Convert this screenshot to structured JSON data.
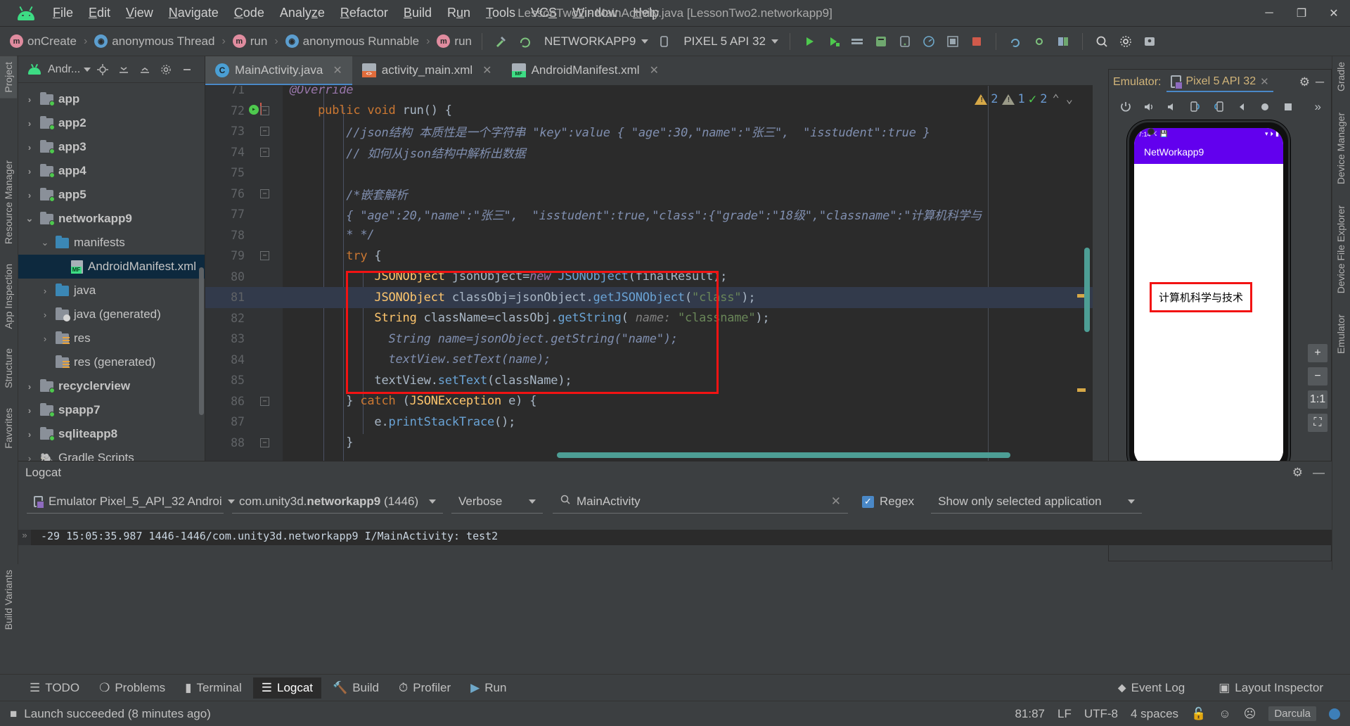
{
  "window": {
    "title": "LessonTwo2 - MainActivity.java [LessonTwo2.networkapp9]",
    "minimize": "─",
    "maximize": "❐",
    "close": "✕"
  },
  "menubar": {
    "items": [
      "File",
      "Edit",
      "View",
      "Navigate",
      "Code",
      "Analyze",
      "Refactor",
      "Build",
      "Run",
      "Tools",
      "VCS",
      "Window",
      "Help"
    ]
  },
  "navbar": {
    "crumbs": [
      {
        "label": "onCreate",
        "icon": "method-icon"
      },
      {
        "label": "anonymous Thread",
        "icon": "class-icon"
      },
      {
        "label": "run",
        "icon": "method-icon"
      },
      {
        "label": "anonymous Runnable",
        "icon": "class-icon"
      },
      {
        "label": "run",
        "icon": "method-icon"
      }
    ],
    "separator": "›",
    "run_config": "NETWORKAPP9",
    "device": "PIXEL 5 API 32"
  },
  "left_strips": {
    "top": [
      "Project"
    ],
    "mid": [
      "Resource Manager",
      "App Inspection",
      "Structure",
      "Favorites"
    ],
    "bottom": [
      "Build Variants"
    ]
  },
  "right_strips": [
    "Gradle",
    "Device Manager",
    "Device File Explorer",
    "Emulator"
  ],
  "project_panel": {
    "title": "Andr...",
    "toolbar_icons": [
      "locate-icon",
      "expand-all-icon",
      "collapse-all-icon",
      "settings-icon",
      "hide-icon"
    ],
    "tree": [
      {
        "label": "app",
        "depth": 0,
        "arrow": "›",
        "icon": "module-folder",
        "bold": true
      },
      {
        "label": "app2",
        "depth": 0,
        "arrow": "›",
        "icon": "module-folder",
        "bold": true
      },
      {
        "label": "app3",
        "depth": 0,
        "arrow": "›",
        "icon": "module-folder",
        "bold": true
      },
      {
        "label": "app4",
        "depth": 0,
        "arrow": "›",
        "icon": "module-folder",
        "bold": true
      },
      {
        "label": "app5",
        "depth": 0,
        "arrow": "›",
        "icon": "module-folder",
        "bold": true
      },
      {
        "label": "networkapp9",
        "depth": 0,
        "arrow": "⌄",
        "icon": "module-folder",
        "bold": true
      },
      {
        "label": "manifests",
        "depth": 1,
        "arrow": "⌄",
        "icon": "blue-folder",
        "bold": false
      },
      {
        "label": "AndroidManifest.xml",
        "depth": 2,
        "arrow": "",
        "icon": "manifest-file",
        "bold": false,
        "selected": true
      },
      {
        "label": "java",
        "depth": 1,
        "arrow": "›",
        "icon": "blue-folder",
        "bold": false
      },
      {
        "label": "java (generated)",
        "depth": 1,
        "arrow": "›",
        "icon": "generated-folder",
        "bold": false
      },
      {
        "label": "res",
        "depth": 1,
        "arrow": "›",
        "icon": "res-folder",
        "bold": false
      },
      {
        "label": "res (generated)",
        "depth": 1,
        "arrow": "",
        "icon": "res-folder",
        "bold": false
      },
      {
        "label": "recyclerview",
        "depth": 0,
        "arrow": "›",
        "icon": "module-folder",
        "bold": true
      },
      {
        "label": "spapp7",
        "depth": 0,
        "arrow": "›",
        "icon": "module-folder",
        "bold": true
      },
      {
        "label": "sqliteapp8",
        "depth": 0,
        "arrow": "›",
        "icon": "module-folder",
        "bold": true
      },
      {
        "label": "Gradle Scripts",
        "depth": 0,
        "arrow": "›",
        "icon": "gradle-icon",
        "bold": false
      }
    ]
  },
  "editor": {
    "tabs": [
      {
        "label": "MainActivity.java",
        "icon": "java-class-icon",
        "active": true,
        "close": "✕"
      },
      {
        "label": "activity_main.xml",
        "icon": "xml-layout-icon",
        "active": false,
        "close": "✕"
      },
      {
        "label": "AndroidManifest.xml",
        "icon": "manifest-icon",
        "active": false,
        "close": "✕"
      }
    ],
    "inspections": {
      "warnings": "2",
      "weak_warnings": "1",
      "ok": "2",
      "prev": "⌃",
      "next": "⌄"
    },
    "lines": [
      {
        "num": "71",
        "partial": true,
        "segments": [
          {
            "t": "@Override",
            "c": "kw2"
          }
        ]
      },
      {
        "num": "72",
        "fold": "⊖",
        "breakpoint": true,
        "segments": [
          {
            "t": "    ",
            "c": "pln"
          },
          {
            "t": "public",
            "c": "kw"
          },
          {
            "t": " ",
            "c": "pln"
          },
          {
            "t": "void",
            "c": "kw"
          },
          {
            "t": " run() {",
            "c": "pln"
          }
        ]
      },
      {
        "num": "73",
        "fold": "⊖",
        "segments": [
          {
            "t": "        //json结构 本质性是一个字符串 \"key\":value { \"age\":30,\"name\":\"张三\",  \"isstudent\":true }",
            "c": "cmtz"
          }
        ]
      },
      {
        "num": "74",
        "fold": "⊖",
        "segments": [
          {
            "t": "        // 如何从json结构中解析出数据",
            "c": "cmtz"
          }
        ]
      },
      {
        "num": "75",
        "segments": []
      },
      {
        "num": "76",
        "fold": "⊖",
        "segments": [
          {
            "t": "        /*嵌套解析",
            "c": "cmtz"
          }
        ]
      },
      {
        "num": "77",
        "segments": [
          {
            "t": "        { \"age\":20,\"name\":\"张三\",  \"isstudent\":true,\"class\":{\"grade\":\"18级\",\"classname\":\"计算机科学与",
            "c": "cmtz"
          }
        ]
      },
      {
        "num": "78",
        "segments": [
          {
            "t": "        * */",
            "c": "cmtz"
          }
        ]
      },
      {
        "num": "79",
        "fold": "⊖",
        "segments": [
          {
            "t": "        ",
            "c": "pln"
          },
          {
            "t": "try",
            "c": "kw"
          },
          {
            "t": " {",
            "c": "pln"
          }
        ]
      },
      {
        "num": "80",
        "segments": [
          {
            "t": "            ",
            "c": "pln"
          },
          {
            "t": "JSONObject",
            "c": "fld"
          },
          {
            "t": " jsonObject=",
            "c": "pln"
          },
          {
            "t": "new",
            "c": "kw2"
          },
          {
            "t": " ",
            "c": "pln"
          },
          {
            "t": "JSONObject",
            "c": "mth"
          },
          {
            "t": "(finalResult);",
            "c": "pln"
          }
        ]
      },
      {
        "num": "81",
        "highlight": true,
        "segments": [
          {
            "t": "            ",
            "c": "pln"
          },
          {
            "t": "JSONObject",
            "c": "fld"
          },
          {
            "t": " classObj=jsonObject.",
            "c": "pln"
          },
          {
            "t": "getJSONObject",
            "c": "mth"
          },
          {
            "t": "(",
            "c": "pln"
          },
          {
            "t": "\"class\"",
            "c": "str"
          },
          {
            "t": ");",
            "c": "pln"
          }
        ]
      },
      {
        "num": "82",
        "segments": [
          {
            "t": "            ",
            "c": "pln"
          },
          {
            "t": "String",
            "c": "fld"
          },
          {
            "t": " className=classObj.",
            "c": "pln"
          },
          {
            "t": "getString",
            "c": "mth"
          },
          {
            "t": "( ",
            "c": "pln"
          },
          {
            "t": "name:",
            "c": "hint"
          },
          {
            "t": " ",
            "c": "pln"
          },
          {
            "t": "\"classname\"",
            "c": "str"
          },
          {
            "t": ");",
            "c": "pln"
          }
        ]
      },
      {
        "num": "83",
        "segments": [
          {
            "t": "              ",
            "c": "pln"
          },
          {
            "t": "String name=jsonObject.getString(\"name\");",
            "c": "cmtz"
          }
        ]
      },
      {
        "num": "84",
        "segments": [
          {
            "t": "              ",
            "c": "pln"
          },
          {
            "t": "textView.setText(name);",
            "c": "cmtz"
          }
        ]
      },
      {
        "num": "85",
        "segments": [
          {
            "t": "            textView.",
            "c": "pln"
          },
          {
            "t": "setText",
            "c": "mth"
          },
          {
            "t": "(className);",
            "c": "pln"
          }
        ]
      },
      {
        "num": "86",
        "fold": "⊖",
        "segments": [
          {
            "t": "        } ",
            "c": "pln"
          },
          {
            "t": "catch",
            "c": "kw"
          },
          {
            "t": " (",
            "c": "pln"
          },
          {
            "t": "JSONException",
            "c": "fld"
          },
          {
            "t": " e) {",
            "c": "pln"
          }
        ]
      },
      {
        "num": "87",
        "segments": [
          {
            "t": "            e.",
            "c": "pln"
          },
          {
            "t": "printStackTrace",
            "c": "mth"
          },
          {
            "t": "();",
            "c": "pln"
          }
        ]
      },
      {
        "num": "88",
        "fold": "⊖",
        "segments": [
          {
            "t": "        }",
            "c": "pln"
          }
        ]
      }
    ]
  },
  "emulator": {
    "title": "Emulator:",
    "tab_label": "Pixel 5 API 32",
    "tab_close": "✕",
    "gear": "⚙",
    "minimize": "─",
    "toolbar_icons": [
      "power-icon",
      "volume-up-icon",
      "volume-down-icon",
      "rotate-left-icon",
      "rotate-right-icon",
      "back-icon",
      "home-icon",
      "overview-icon",
      "more-icon"
    ],
    "more": "»",
    "device_screen": {
      "status_time": "7:14",
      "status_left_icons": [
        "bluetooth-icon",
        "save-icon"
      ],
      "status_right_icons": [
        "wifi-icon",
        "signal-icon",
        "battery-icon"
      ],
      "app_title": "NetWorkapp9",
      "result_text": "计算机科学与技术"
    },
    "side_buttons": [
      "+",
      "−",
      "1:1",
      "⛶"
    ]
  },
  "logcat": {
    "panel_title": "Logcat",
    "device": "Emulator Pixel_5_API_32 Androi",
    "process_prefix": "com.unity3d.",
    "process_bold": "networkapp9",
    "process_pid": "(1446)",
    "level": "Verbose",
    "search_value": "MainActivity",
    "search_clear": "✕",
    "regex_label": "Regex",
    "regex_checked": true,
    "check_glyph": "✓",
    "filter_preset": "Show only selected application",
    "log_line": "-29 15:05:35.987 1446-1446/com.unity3d.networkapp9 I/MainActivity: test2",
    "header_icons": [
      "settings-icon",
      "hide-icon"
    ]
  },
  "bottom_tabs": [
    {
      "label": "TODO",
      "icon": "todo-icon",
      "active": false
    },
    {
      "label": "Problems",
      "icon": "problems-icon",
      "active": false
    },
    {
      "label": "Terminal",
      "icon": "terminal-icon",
      "active": false
    },
    {
      "label": "Logcat",
      "icon": "logcat-icon",
      "active": true
    },
    {
      "label": "Build",
      "icon": "build-icon",
      "active": false
    },
    {
      "label": "Profiler",
      "icon": "profiler-icon",
      "active": false
    },
    {
      "label": "Run",
      "icon": "run-icon",
      "active": false
    }
  ],
  "bottom_right": [
    {
      "label": "Event Log",
      "icon": "event-log-icon"
    },
    {
      "label": "Layout Inspector",
      "icon": "layout-inspector-icon"
    }
  ],
  "statusbar": {
    "message": "Launch succeeded (8 minutes ago)",
    "caret_position": "81:87",
    "line_separator": "LF",
    "encoding": "UTF-8",
    "indent": "4 spaces",
    "lock_icon": "🔓",
    "happy_face": "☺",
    "sad_face": "☹",
    "theme": "Darcula"
  },
  "colors": {
    "chrome": "#3c3f41",
    "editor_bg": "#2b2b2b",
    "accent_blue": "#4a88c7",
    "highlight_red": "#f21313",
    "android_green": "#3ddc84",
    "app_purple": "#6200ee",
    "selected_row": "#0d293e"
  }
}
